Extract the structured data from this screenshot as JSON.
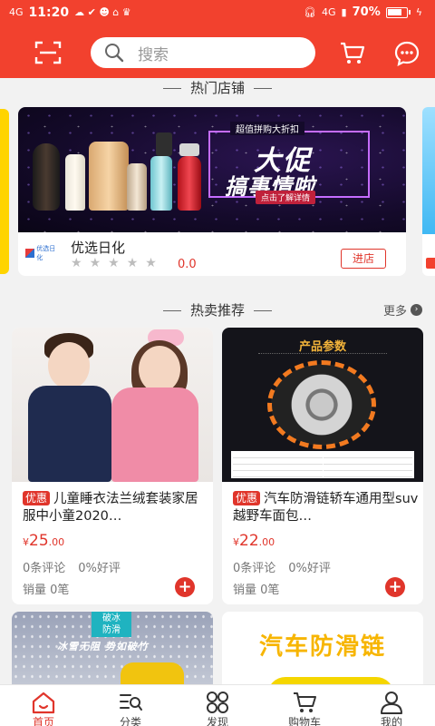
{
  "status_bar": {
    "time": "11:20",
    "network_left": "4G",
    "network_right": "4G",
    "battery": "70%"
  },
  "header": {
    "search_placeholder": "搜索",
    "icons": [
      "scan-icon",
      "search-icon",
      "cart-icon",
      "message-icon"
    ]
  },
  "hot_shops": {
    "title": "热门店铺",
    "shop": {
      "banner_subtitle": "超值拼购大折扣",
      "banner_line1": "大促",
      "banner_line2": "搞事情啦",
      "banner_cta": "点击了解详情",
      "logo_text": "优选日化",
      "name": "优选日化",
      "score": "0.0",
      "enter_label": "进店"
    }
  },
  "hot_sale": {
    "title": "热卖推荐",
    "more_label": "更多",
    "products": [
      {
        "tag": "优惠",
        "title": "儿童睡衣法兰绒套装家居服中小童2020…",
        "currency": "¥",
        "price_int": "25",
        "price_dec": ".00",
        "reviews": "0条评论",
        "positive": "0%好评",
        "sales": "销量 0笔"
      },
      {
        "tag": "优惠",
        "title": "汽车防滑链轿车通用型suv越野车面包…",
        "currency": "¥",
        "price_int": "22",
        "price_dec": ".00",
        "reviews": "0条评论",
        "positive": "0%好评",
        "sales": "销量 0笔",
        "image_title": "产品参数"
      }
    ],
    "partial_cards": [
      {
        "tag_line1": "破冰",
        "tag_line2": "防滑",
        "slogan": "冰雪无阻 势如破竹"
      },
      {
        "title": "汽车防滑链"
      }
    ]
  },
  "tabbar": {
    "items": [
      {
        "label": "首页",
        "icon": "home-icon",
        "active": true
      },
      {
        "label": "分类",
        "icon": "category-icon",
        "active": false
      },
      {
        "label": "发现",
        "icon": "discover-icon",
        "active": false
      },
      {
        "label": "购物车",
        "icon": "cart-icon",
        "active": false
      },
      {
        "label": "我的",
        "icon": "profile-icon",
        "active": false
      }
    ]
  },
  "colors": {
    "primary": "#f2412e",
    "price": "#e0352b",
    "background": "#f2f2f2"
  }
}
